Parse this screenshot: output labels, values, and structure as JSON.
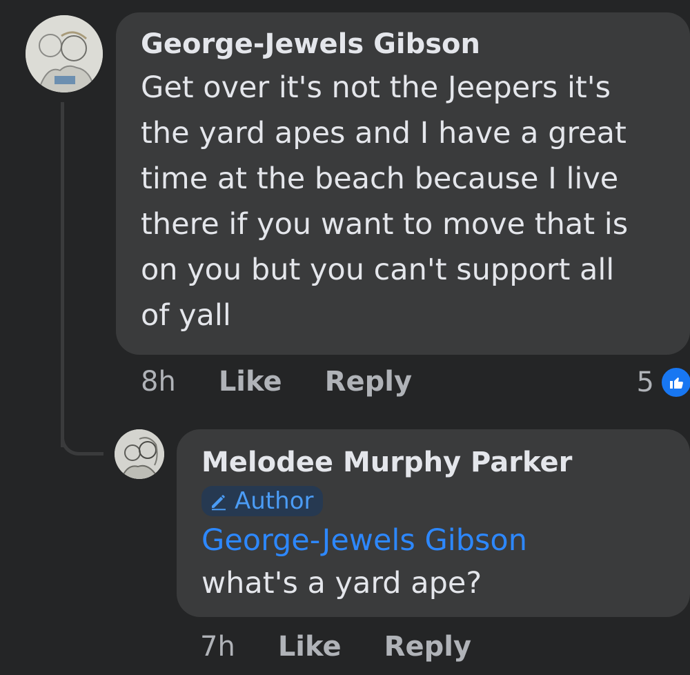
{
  "comments": [
    {
      "author": "George-Jewels Gibson",
      "text": "Get over it's not the Jeepers it's\nthe yard apes and I have a great\ntime at the beach because I live\nthere if you want to move that is\non you but you can't support all\nof yall",
      "time": "8h",
      "like_label": "Like",
      "reply_label": "Reply",
      "reaction_count": "5",
      "reaction_icon": "thumbs-up-icon"
    }
  ],
  "reply": {
    "author": "Melodee Murphy Parker",
    "badge": "Author",
    "badge_icon": "pencil-icon",
    "mention": "George-Jewels Gibson",
    "text": "what's a yard ape?",
    "time": "7h",
    "like_label": "Like",
    "reply_label": "Reply"
  },
  "colors": {
    "background": "#242526",
    "bubble": "#3a3b3c",
    "primary_text": "#e4e6eb",
    "secondary_text": "#b0b3b8",
    "link": "#2d88ff",
    "badge_bg": "#263951",
    "reaction": "#1877f2"
  }
}
